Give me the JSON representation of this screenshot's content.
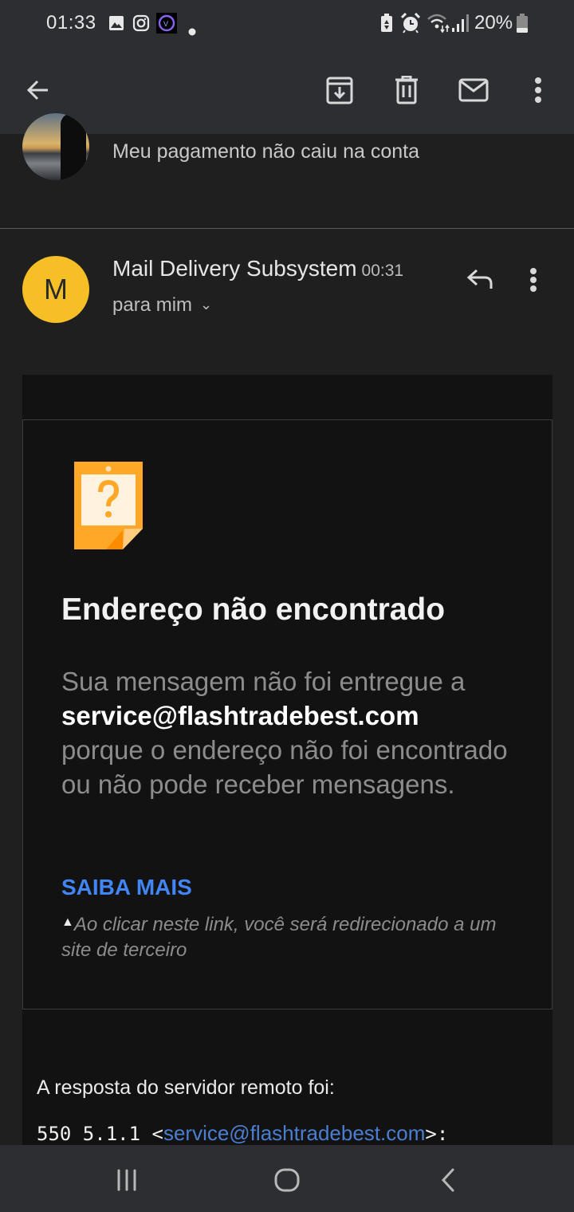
{
  "status_bar": {
    "time": "01:33",
    "left_icons": [
      "gallery-icon",
      "instagram-icon",
      "app-v-icon",
      "notification-dot-icon"
    ],
    "right_icons": [
      "battery-saver-icon",
      "alarm-icon",
      "wifi-icon",
      "signal-icon"
    ],
    "battery_percent": "20%"
  },
  "app_bar": {
    "actions": [
      "back",
      "archive",
      "delete",
      "mark-unread",
      "more-options"
    ]
  },
  "previous_message": {
    "subject": "Meu pagamento não caiu na conta"
  },
  "message": {
    "avatar_letter": "M",
    "avatar_color": "#f6bf26",
    "sender": "Mail Delivery Subsystem",
    "time": "00:31",
    "recipient": "para mim",
    "recipient_chevron": "⌄"
  },
  "bounce_card": {
    "heading": "Endereço não encontrado",
    "body_prefix": "Sua mensagem não foi entregue a",
    "address": "service@flashtradebest.com",
    "body_suffix": "porque o endereço não foi encontrado ou não pode receber mensagens.",
    "learn_more": "SAIBA MAIS",
    "learn_more_color": "#4285f4",
    "warning_symbol": "▲",
    "warning_text": "Ao clicar neste link, você será redirecionado a um site de terceiro"
  },
  "server_response": {
    "label": "A resposta do servidor remoto foi:",
    "code": "550 5.1.1 <",
    "address": "service@flashtradebest.com",
    "code_suffix": ">:"
  },
  "nav_bar": {
    "buttons": [
      "recent-apps",
      "home",
      "back"
    ]
  }
}
